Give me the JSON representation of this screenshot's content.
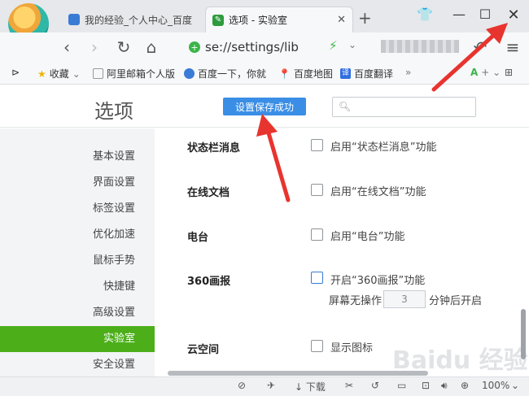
{
  "tabs": [
    {
      "label": "我的经验_个人中心_百度"
    },
    {
      "label": "选项 - 实验室"
    }
  ],
  "address": {
    "url": "se://settings/lib"
  },
  "bookmarks": [
    {
      "label": "收藏"
    },
    {
      "label": "阿里邮箱个人版"
    },
    {
      "label": "百度一下，你就"
    },
    {
      "label": "百度地图"
    },
    {
      "label": "百度翻译"
    }
  ],
  "page": {
    "title": "选项",
    "toast": "设置保存成功",
    "search_placeholder": ""
  },
  "sidebar": {
    "items": [
      {
        "label": "基本设置"
      },
      {
        "label": "界面设置"
      },
      {
        "label": "标签设置"
      },
      {
        "label": "优化加速"
      },
      {
        "label": "鼠标手势"
      },
      {
        "label": "快捷键"
      },
      {
        "label": "高级设置"
      },
      {
        "label": "实验室"
      },
      {
        "label": "安全设置"
      }
    ],
    "active_index": 7
  },
  "settings": [
    {
      "label": "状态栏消息",
      "option": "启用“状态栏消息”功能",
      "checked": false
    },
    {
      "label": "在线文档",
      "option": "启用“在线文档”功能",
      "checked": false
    },
    {
      "label": "电台",
      "option": "启用“电台”功能",
      "checked": false
    },
    {
      "label": "360画报",
      "option": "开启“360画报”功能",
      "checked": false,
      "idle_prefix": "屏幕无操作",
      "idle_value": "3",
      "idle_suffix": "分钟后开启"
    },
    {
      "label": "云空间",
      "option": "显示图标",
      "checked": false
    }
  ],
  "statusbar": {
    "download": "下载",
    "zoom": "100%"
  },
  "colors": {
    "accent_green": "#4caf1a",
    "toast_blue": "#3a8ee6",
    "annotation_red": "#e8342f"
  }
}
